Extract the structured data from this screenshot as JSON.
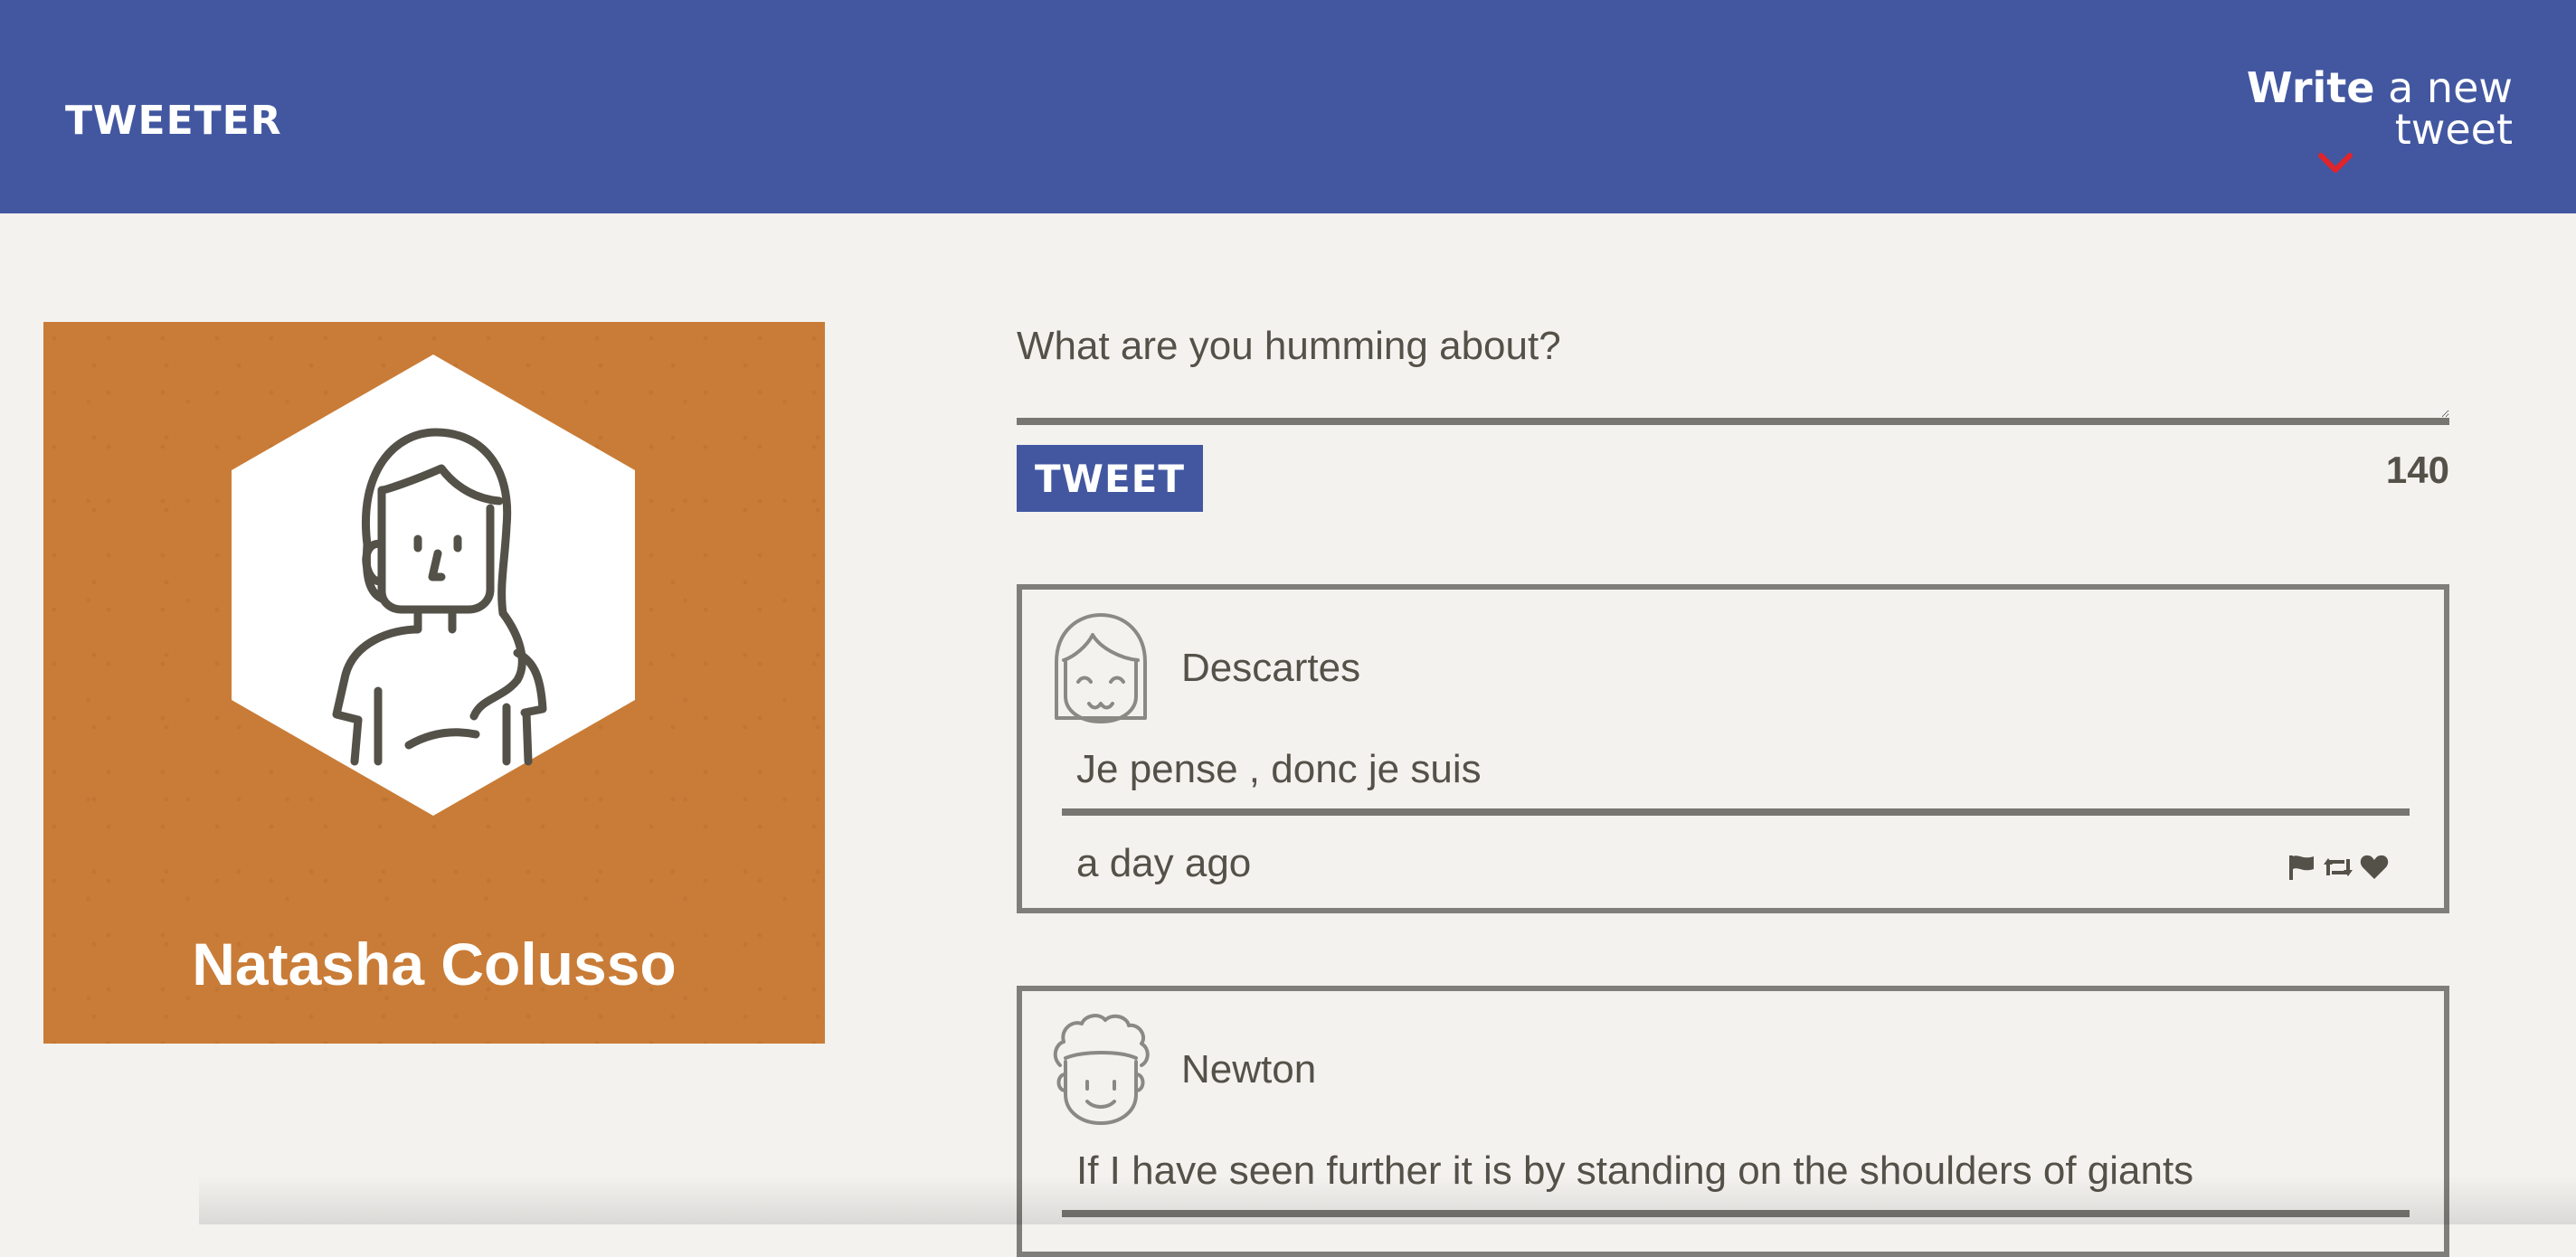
{
  "header": {
    "brand": "TWEETER",
    "compose_prefix": "Write",
    "compose_suffix": " a new tweet",
    "chevron_icon": "chevron-down-icon",
    "chevron_color": "#e0242b",
    "bar_color": "#4257a0"
  },
  "profile": {
    "name": "Natasha Colusso",
    "avatar_icon": "woman-avatar-icon",
    "card_color": "#c97c37"
  },
  "composer": {
    "placeholder": "What are you humming about?",
    "tweet_button_label": "TWEET",
    "char_counter": "140"
  },
  "tweets": [
    {
      "handle": "Descartes",
      "avatar_icon": "smiling-girl-avatar-icon",
      "text": "Je pense , donc je suis",
      "time": "a day ago",
      "actions": [
        "flag-icon",
        "retweet-icon",
        "heart-icon"
      ]
    },
    {
      "handle": "Newton",
      "avatar_icon": "curly-hair-man-avatar-icon",
      "text": "If I have seen further it is by standing on the shoulders of giants"
    }
  ]
}
